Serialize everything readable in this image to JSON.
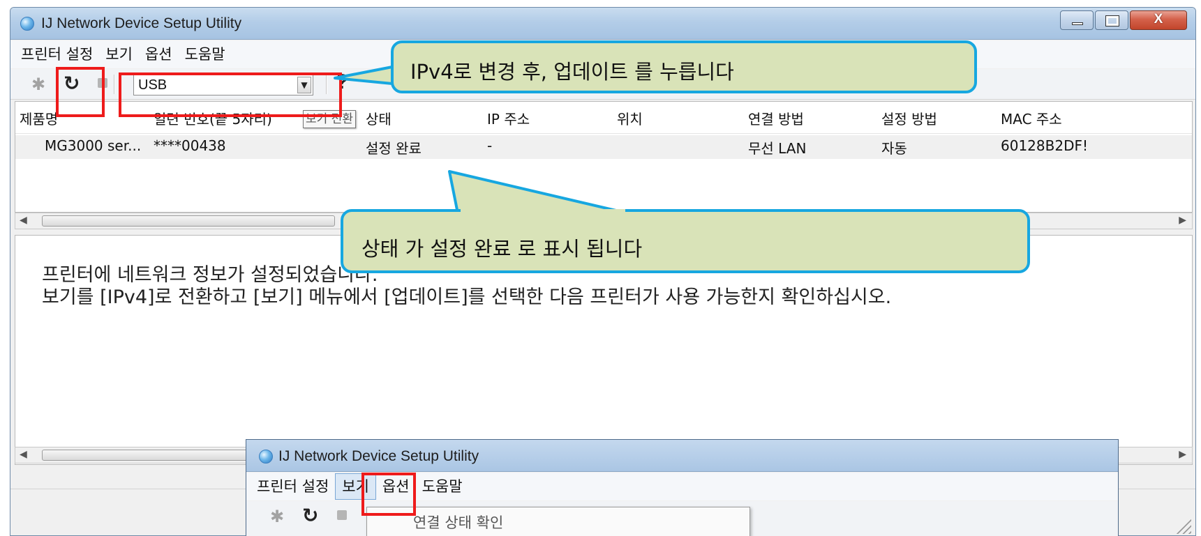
{
  "window": {
    "title": "IJ Network Device Setup Utility",
    "controls": {
      "minimize": "—",
      "maximize": "□",
      "close": "X"
    }
  },
  "menu": [
    "프린터 설정",
    "보기",
    "옵션",
    "도움말"
  ],
  "toolbar": {
    "icons": [
      "settings-icon",
      "refresh-icon",
      "stop-icon",
      "help-icon"
    ],
    "view_select_value": "USB",
    "help_label": "?"
  },
  "table": {
    "columns": [
      "제품명",
      "일련 번호(끝 5자리)",
      "상태",
      "IP 주소",
      "위치",
      "연결 방법",
      "설정 방법",
      "MAC 주소"
    ],
    "rows": [
      [
        "MG3000 ser...",
        "****00438",
        "설정 완료",
        "-",
        "",
        "무선 LAN",
        "자동",
        "60128B2DF!"
      ]
    ],
    "tooltip": "보기 전환"
  },
  "info": {
    "line1": "프린터에 네트워크 정보가 설정되었습니다.",
    "line2": "보기를 [IPv4]로 전환하고 [보기] 메뉴에서 [업데이트]를 선택한 다음 프린터가 사용 가능한지 확인하십시오."
  },
  "callouts": {
    "top": "IPv4로 변경 후, 업데이트 를 누릅니다",
    "middle": "상태 가 설정 완료 로 표시 됩니다"
  },
  "inset": {
    "title": "IJ Network Device Setup Utility",
    "menu": [
      "프린터 설정",
      "보기",
      "옵션",
      "도움말"
    ],
    "dropdown_item": "연결 상태 확인"
  },
  "colors": {
    "callout_fill": "#d9e3b8",
    "callout_border": "#17a7e0",
    "highlight": "#ee1b1b"
  }
}
